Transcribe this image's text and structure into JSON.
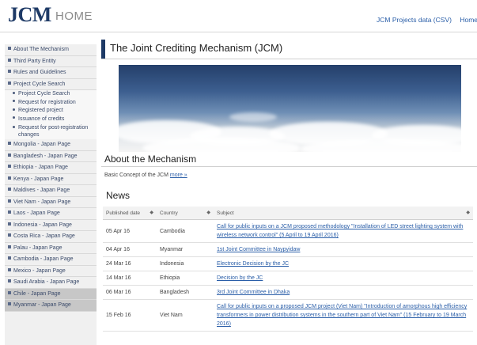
{
  "header": {
    "logo": "JCM",
    "home": "HOME",
    "links": [
      "JCM Projects data (CSV)",
      "Home"
    ]
  },
  "sidebar": {
    "items": [
      {
        "label": "About The Mechanism"
      },
      {
        "label": "Third Party Entity"
      },
      {
        "label": "Rules and Guidelines"
      },
      {
        "label": "Project Cycle Search"
      }
    ],
    "subitems": [
      "Project Cycle Search",
      "Request for registration",
      "Registered project",
      "Issuance of credits",
      "Request for post-registration changes"
    ],
    "countries": [
      "Mongolia - Japan Page",
      "Bangladesh - Japan Page",
      "Ethiopia - Japan Page",
      "Kenya - Japan Page",
      "Maldives - Japan Page",
      "Viet Nam - Japan Page",
      "Laos - Japan Page",
      "Indonesia - Japan Page",
      "Costa Rica - Japan Page",
      "Palau - Japan Page",
      "Cambodia - Japan Page",
      "Mexico - Japan Page",
      "Saudi Arabia - Japan Page",
      "Chile - Japan Page",
      "Myanmar - Japan Page"
    ]
  },
  "main": {
    "title": "The Joint Crediting Mechanism (JCM)",
    "about_heading": "About the Mechanism",
    "basic_text": "Basic Concept of the JCM",
    "basic_link": "more »",
    "news_heading": "News",
    "columns": [
      "Published date",
      "Country",
      "Subject"
    ],
    "rows": [
      {
        "date": "05 Apr 16",
        "country": "Cambodia",
        "subject": "Call for public inputs on a JCM proposed methodology \"Installation of LED street lighting system with wireless network control\" (5 April to 19 April 2016)"
      },
      {
        "date": "04 Apr 16",
        "country": "Myanmar",
        "subject": "1st Joint Committee in Naypyidaw"
      },
      {
        "date": "24 Mar 16",
        "country": "Indonesia",
        "subject": "Electronic Decision by the JC"
      },
      {
        "date": "14 Mar 16",
        "country": "Ethiopia",
        "subject": "Decision by the JC"
      },
      {
        "date": "06 Mar 16",
        "country": "Bangladesh",
        "subject": "3rd Joint Committee in Dhaka"
      },
      {
        "date": "15 Feb 16",
        "country": "Viet Nam",
        "subject": "Call for public inputs on a proposed JCM project (Viet Nam) \"Introduction of amorphous high efficiency transformers in power distribution systems in the southern part of Viet Nam\" (15 February to 19 March 2016)"
      }
    ]
  }
}
